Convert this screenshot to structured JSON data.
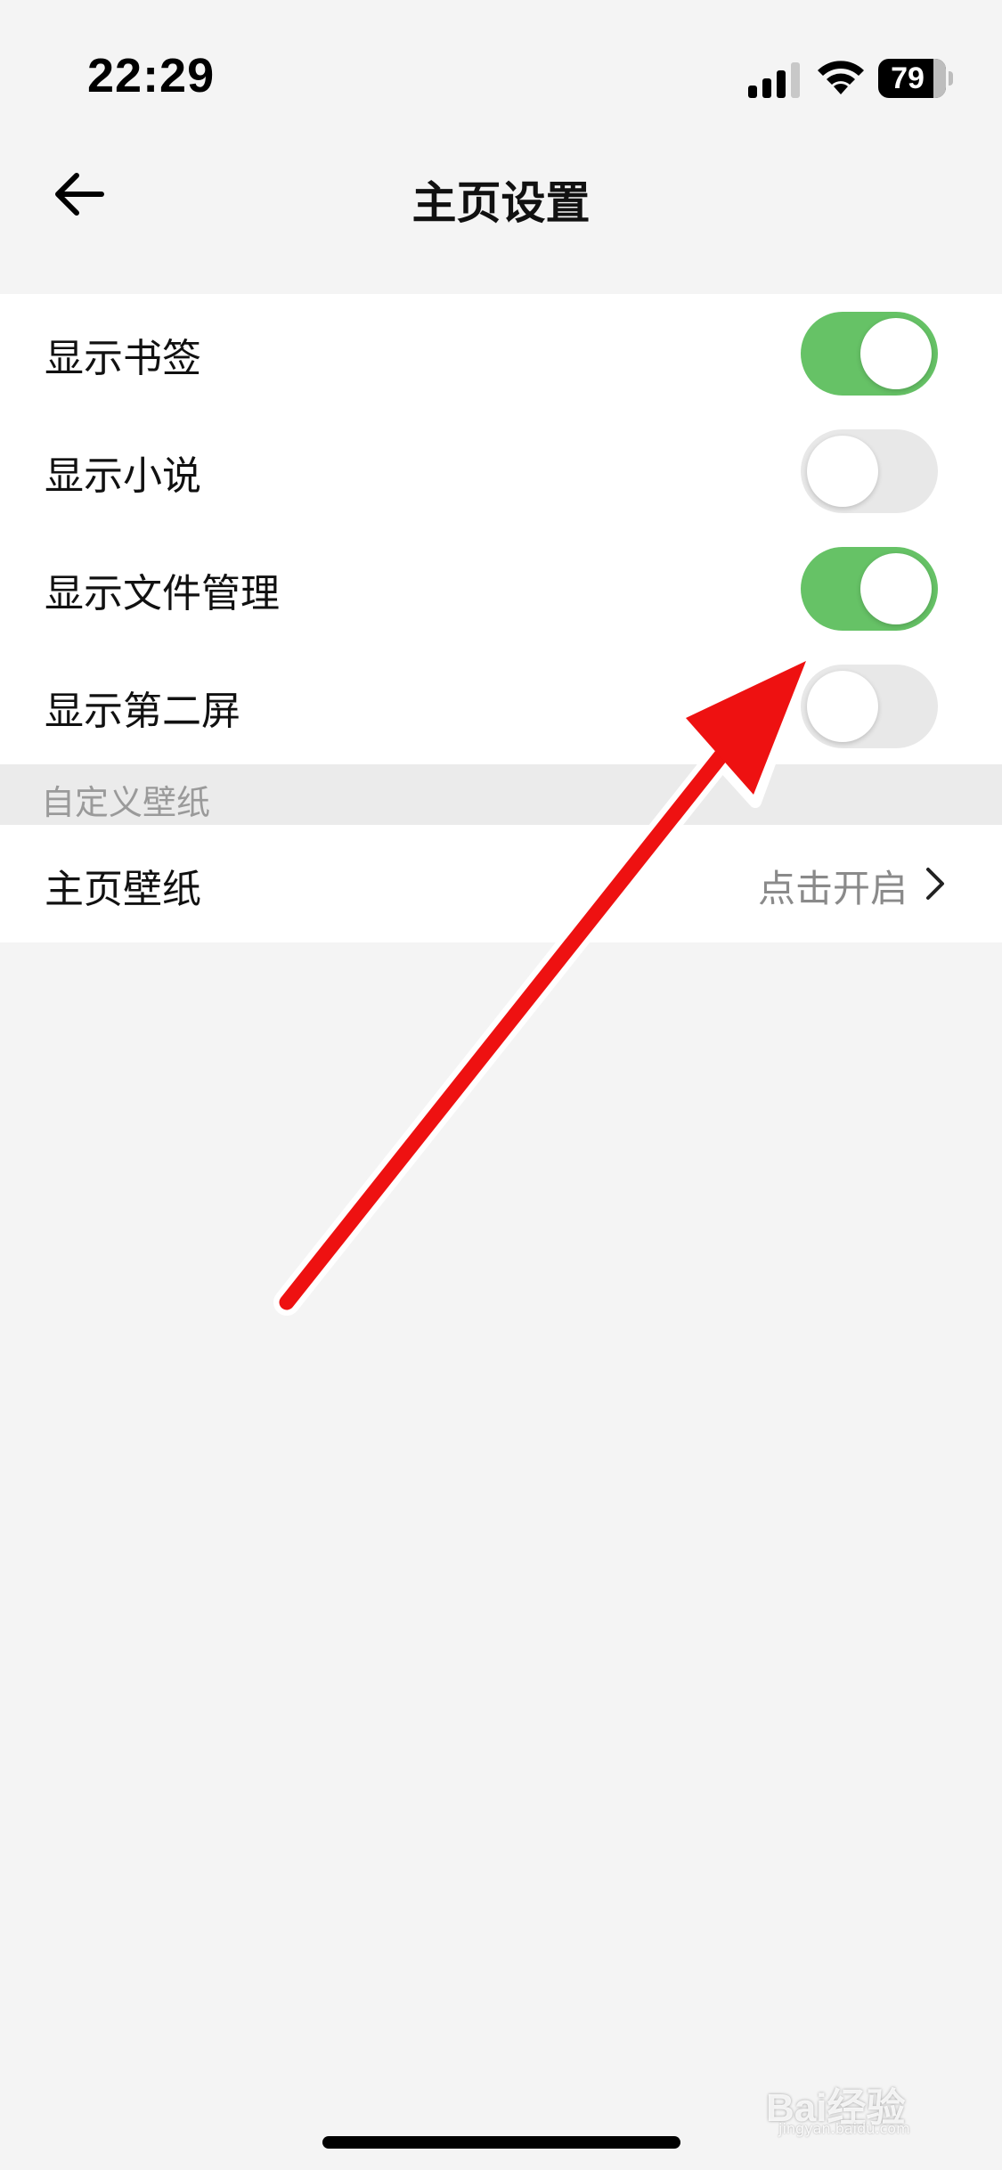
{
  "status_bar": {
    "time": "22:29",
    "battery_level": "79",
    "icons": [
      "signal-icon",
      "wifi-icon",
      "battery-icon"
    ]
  },
  "header": {
    "title": "主页设置",
    "back_icon": "arrow-left-icon"
  },
  "settings": {
    "items": [
      {
        "label": "显示书签",
        "enabled": true
      },
      {
        "label": "显示小说",
        "enabled": false
      },
      {
        "label": "显示文件管理",
        "enabled": true
      },
      {
        "label": "显示第二屏",
        "enabled": false
      }
    ]
  },
  "wallpaper_section": {
    "header": "自定义壁纸",
    "row_label": "主页壁纸",
    "row_value": "点击开启"
  },
  "annotation": {
    "type": "arrow",
    "color": "#ee1111",
    "points_to": "显示第二屏"
  },
  "watermark": {
    "text": "Bai经验",
    "sub": "jingyan.baidu.com"
  },
  "colors": {
    "toggle_on": "#66c266",
    "toggle_off": "#e8e8e8",
    "background": "#f4f4f4"
  }
}
